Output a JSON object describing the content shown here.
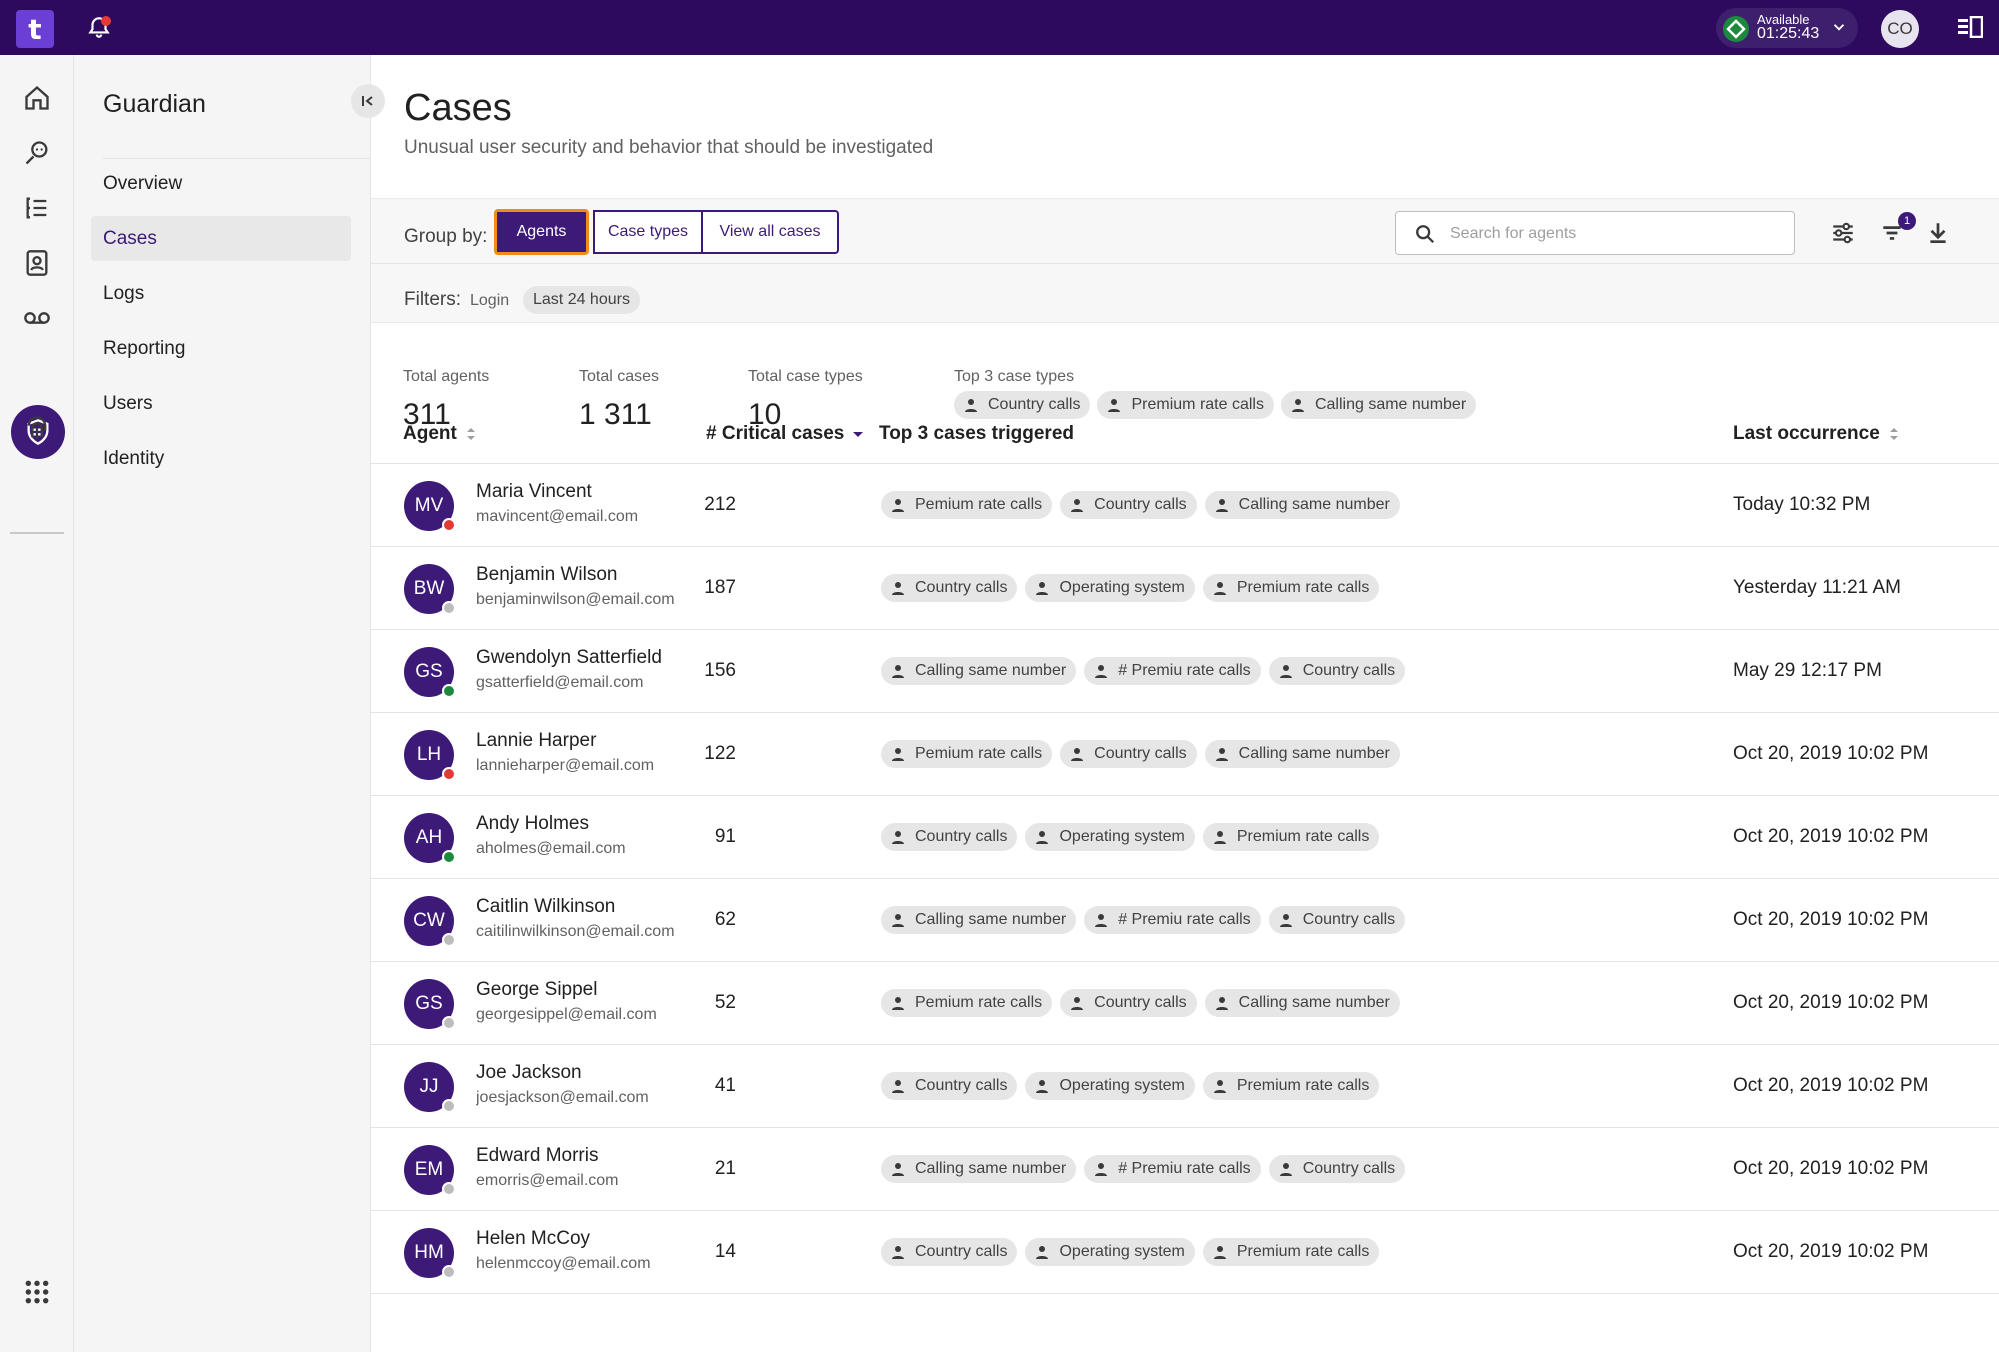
{
  "app": {
    "logo_text": "t",
    "brand_color": "#2d0a5e",
    "accent_color": "#3d1a78"
  },
  "topbar": {
    "status_label": "Available",
    "status_timer": "01:25:43",
    "user_initials": "CO"
  },
  "sidebar": {
    "title": "Guardian",
    "items": [
      {
        "label": "Overview",
        "active": false
      },
      {
        "label": "Cases",
        "active": true
      },
      {
        "label": "Logs",
        "active": false
      },
      {
        "label": "Reporting",
        "active": false
      },
      {
        "label": "Users",
        "active": false
      },
      {
        "label": "Identity",
        "active": false
      }
    ]
  },
  "page": {
    "title": "Cases",
    "subtitle": "Unusual user security and behavior that should be investigated"
  },
  "toolbar": {
    "group_by_label": "Group by:",
    "group_by_options": [
      "Agents",
      "Case types",
      "View all cases"
    ],
    "group_by_selected": "Agents",
    "search_placeholder": "Search for agents",
    "filter_badge": "1"
  },
  "filters": {
    "label": "Filters:",
    "type": "Login",
    "chips": [
      "Last 24 hours"
    ]
  },
  "stats": {
    "total_agents_label": "Total agents",
    "total_agents": "311",
    "total_cases_label": "Total cases",
    "total_cases": "1 311",
    "total_case_types_label": "Total case types",
    "total_case_types": "10",
    "top3_label": "Top 3 case types",
    "top3": [
      "Country calls",
      "Premium rate calls",
      "Calling same number"
    ]
  },
  "table": {
    "columns": {
      "agent": "Agent",
      "critical": "# Critical cases",
      "top3": "Top 3 cases triggered",
      "last": "Last occurrence"
    },
    "rows": [
      {
        "initials": "MV",
        "name": "Maria Vincent",
        "email": "mavincent@email.com",
        "status": "#e53935",
        "count": "212",
        "cases": [
          "Pemium rate calls",
          "Country calls",
          "Calling same number"
        ],
        "last": "Today 10:32 PM"
      },
      {
        "initials": "BW",
        "name": "Benjamin Wilson",
        "email": "benjaminwilson@email.com",
        "status": "#bdbdbd",
        "count": "187",
        "cases": [
          "Country calls",
          "Operating system",
          "Premium rate calls"
        ],
        "last": "Yesterday 11:21 AM"
      },
      {
        "initials": "GS",
        "name": "Gwendolyn Satterfield",
        "email": "gsatterfield@email.com",
        "status": "#1b8a3c",
        "count": "156",
        "cases": [
          "Calling same number",
          "# Premiu rate calls",
          "Country calls"
        ],
        "last": "May 29 12:17 PM"
      },
      {
        "initials": "LH",
        "name": "Lannie Harper",
        "email": "lannieharper@email.com",
        "status": "#e53935",
        "count": "122",
        "cases": [
          "Pemium rate calls",
          "Country calls",
          "Calling same number"
        ],
        "last": "Oct 20, 2019 10:02 PM"
      },
      {
        "initials": "AH",
        "name": "Andy Holmes",
        "email": "aholmes@email.com",
        "status": "#1b8a3c",
        "count": "91",
        "cases": [
          "Country calls",
          "Operating system",
          "Premium rate calls"
        ],
        "last": "Oct 20, 2019 10:02 PM"
      },
      {
        "initials": "CW",
        "name": "Caitlin Wilkinson",
        "email": "caitilinwilkinson@email.com",
        "status": "#bdbdbd",
        "count": "62",
        "cases": [
          "Calling same number",
          "# Premiu rate calls",
          "Country calls"
        ],
        "last": "Oct 20, 2019 10:02 PM"
      },
      {
        "initials": "GS",
        "name": "George Sippel",
        "email": "georgesippel@email.com",
        "status": "#bdbdbd",
        "count": "52",
        "cases": [
          "Pemium rate calls",
          "Country calls",
          "Calling same number"
        ],
        "last": "Oct 20, 2019 10:02 PM"
      },
      {
        "initials": "JJ",
        "name": "Joe Jackson",
        "email": "joesjackson@email.com",
        "status": "#bdbdbd",
        "count": "41",
        "cases": [
          "Country calls",
          "Operating system",
          "Premium rate calls"
        ],
        "last": "Oct 20, 2019 10:02 PM"
      },
      {
        "initials": "EM",
        "name": "Edward Morris",
        "email": "emorris@email.com",
        "status": "#bdbdbd",
        "count": "21",
        "cases": [
          "Calling same number",
          "# Premiu rate calls",
          "Country calls"
        ],
        "last": "Oct 20, 2019 10:02 PM"
      },
      {
        "initials": "HM",
        "name": "Helen McCoy",
        "email": "helenmccoy@email.com",
        "status": "#bdbdbd",
        "count": "14",
        "cases": [
          "Country calls",
          "Operating system",
          "Premium rate calls"
        ],
        "last": "Oct 20, 2019 10:02 PM"
      }
    ]
  }
}
